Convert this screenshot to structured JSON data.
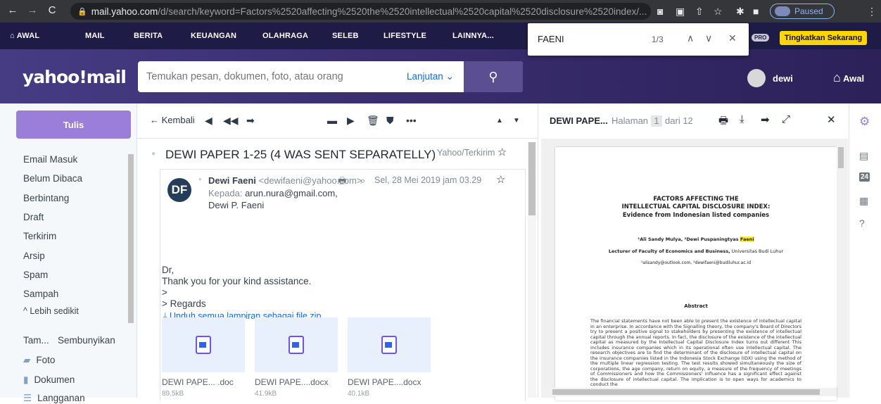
{
  "browser": {
    "url_domain": "mail.yahoo.com",
    "url_path": "/d/search/keyword=Factors%2520affecting%2520the%2520intellectual%2520capital%2520disclosure%2520index/...",
    "profile_status": "Paused"
  },
  "topnav": {
    "items": [
      "AWAL",
      "MAIL",
      "BERITA",
      "KEUANGAN",
      "OLAHRAGA",
      "SELEB",
      "LIFESTYLE",
      "LAINNYA..."
    ],
    "pro_badge": "PRO",
    "upgrade": "Tingkatkan Sekarang"
  },
  "findbar": {
    "query": "FAENI",
    "count": "1/3"
  },
  "header": {
    "logo": "yahoo!mail",
    "search_placeholder": "Temukan pesan, dokumen, foto, atau orang",
    "advanced": "Lanjutan",
    "username": "dewi",
    "home": "Awal"
  },
  "sidebar": {
    "compose": "Tulis",
    "folders": [
      "Email Masuk",
      "Belum Dibaca",
      "Berbintang",
      "Draft",
      "Terkirim",
      "Arsip",
      "Spam",
      "Sampah"
    ],
    "less": "Lebih sedikit",
    "views_label": "Tam...",
    "hide": "Sembunyikan",
    "views": [
      "Foto",
      "Dokumen",
      "Langganan"
    ]
  },
  "toolbar": {
    "back": "Kembali"
  },
  "message": {
    "subject": "DEWI PAPER 1-25 (4 WAS SENT SEPARATELLY)",
    "folder": "Yahoo/Terkirim",
    "avatar_initials": "DF",
    "sender_name": "Dewi Faeni",
    "sender_email": "<dewifaeni@yahoo.com>",
    "date": "Sel, 28 Mei 2019 jam 03.29",
    "to_label": "Kepada:",
    "to_email": "arun.nura@gmail.com,",
    "to_name": "Dewi P. Faeni",
    "body": [
      "Dr,",
      "Thank you for your kind assistance.",
      ">",
      "> Regards"
    ],
    "download_all": "Unduh semua lampiran sebagai file zip",
    "attachments": [
      {
        "name": "DEWI PAPE...  .doc",
        "size": "89.5kB"
      },
      {
        "name": "DEWI PAPE....docx",
        "size": "41.9kB"
      },
      {
        "name": "DEWI PAPE....docx",
        "size": "40.1kB"
      }
    ]
  },
  "preview": {
    "title": "DEWI PAPE...",
    "page_label": "Halaman",
    "page_current": "1",
    "page_total": "dari 12",
    "doc": {
      "title1": "FACTORS AFFECTING THE",
      "title2": "INTELLECTUAL CAPITAL DISCLOSURE INDEX:",
      "title3": "Evidence from Indonesian listed companies",
      "authors_pre": "¹Ali Sandy Mulya, ²Dewi Puspaningtyas ",
      "authors_hl": "Faeni",
      "affil_bold": "Lecturer of Faculty of Economics and Business,",
      "affil_rest": " Universitas Budi Luhur",
      "emails": "¹alisandy@outlook.com, ²dewifaeni@budiluhur.ac.id",
      "abstract_title": "Abstract",
      "abstract": "The financial statements have not been able to present the existence of intellectual capital in an enterprise. In accordance with the Signalling theory, the company's Board of Directors try to present a positive signal to stakeholders by presenting the existence of intellectual capital through the annual reports. In fact, the disclosure of the existence of the intellectual capital as measured by the Intellectual Capital Disclosure Index turns out different This includes insurance companies which in its operational often use intellectual capital. The research objectives are to find the determinant of the disclosure of intellectual capital on the insurance companies listed in the Indonesia Stock Exchange (IDX) using the method of the multiple linear regression testing. The test results showed simultaneously the size of corporations, the age company, return on equity, a measure of the frequency of meetings of Commissioners and how the Commissioners' influence has a significant effect against the disclosure of intellectual capital. The implication is to open ways for academics to conduct the"
    }
  }
}
